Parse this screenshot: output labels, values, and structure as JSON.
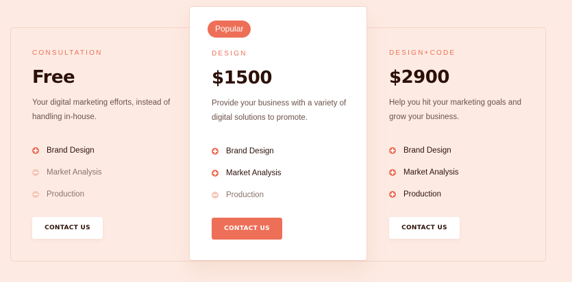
{
  "accent_color": "#ee6f58",
  "background_color": "#fdebe3",
  "plans": [
    {
      "label": "CONSULTATION",
      "price": "Free",
      "description": "Your digital marketing efforts, instead of handling in-house.",
      "features": [
        {
          "label": "Brand Design",
          "included": true,
          "icon": "plus-circle-icon"
        },
        {
          "label": "Market Analysis",
          "included": false,
          "icon": "minus-circle-icon"
        },
        {
          "label": "Production",
          "included": false,
          "icon": "minus-circle-icon"
        }
      ],
      "cta_label": "CONTACT US"
    },
    {
      "badge": "Popular",
      "label": "DESIGN",
      "price": "$1500",
      "description": "Provide your business with a variety of digital solutions to promote.",
      "features": [
        {
          "label": "Brand Design",
          "included": true,
          "icon": "plus-circle-icon"
        },
        {
          "label": "Market Analysis",
          "included": true,
          "icon": "plus-circle-icon"
        },
        {
          "label": "Production",
          "included": false,
          "icon": "minus-circle-icon"
        }
      ],
      "cta_label": "CONTACT US"
    },
    {
      "label": "DESIGN+CODE",
      "price": "$2900",
      "description": "Help you hit your marketing goals and grow your business.",
      "features": [
        {
          "label": "Brand Design",
          "included": true,
          "icon": "plus-circle-icon"
        },
        {
          "label": "Market Analysis",
          "included": true,
          "icon": "plus-circle-icon"
        },
        {
          "label": "Production",
          "included": true,
          "icon": "plus-circle-icon"
        }
      ],
      "cta_label": "CONTACT US"
    }
  ]
}
